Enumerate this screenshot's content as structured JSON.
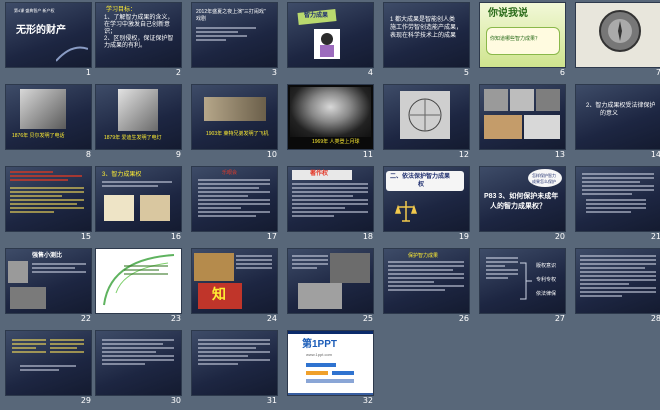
{
  "slides": [
    {
      "num": "1",
      "texts": [
        "无形的财产",
        "第4课  盛典智产 新产权"
      ]
    },
    {
      "num": "2",
      "texts": [
        "学习目标：",
        "1、了解智力成果的含义，",
        "在学习中激发自己创新意",
        "识；",
        "2、区别侵权，保证保护智",
        "力成果的有利。"
      ]
    },
    {
      "num": "3",
      "texts": [
        "2012年盛夏之夜上演\"三打闹戏\"",
        "戏剧"
      ]
    },
    {
      "num": "4",
      "texts": [
        "智力成果"
      ]
    },
    {
      "num": "5",
      "texts": [
        "1  都大成果是智能创人类",
        "施工作劳智创造能产成果，",
        "表现在科学技术上的成果"
      ]
    },
    {
      "num": "6",
      "texts": [
        "你说我说",
        "你知道哪些智力成果？"
      ]
    },
    {
      "num": "7",
      "texts": []
    },
    {
      "num": "8",
      "texts": [
        "1876年 贝尔发明了电话"
      ]
    },
    {
      "num": "9",
      "texts": [
        "1879年 爱迪生发明了电灯"
      ]
    },
    {
      "num": "10",
      "texts": [
        "1903年 莱特兄弟发明了飞机"
      ]
    },
    {
      "num": "11",
      "texts": [
        "1969年 人类登上月球"
      ]
    },
    {
      "num": "12",
      "texts": []
    },
    {
      "num": "13",
      "texts": []
    },
    {
      "num": "14",
      "texts": [
        "2、智力成果权受法律保护",
        "的意义"
      ]
    },
    {
      "num": "15",
      "texts": []
    },
    {
      "num": "16",
      "texts": [
        "3、智力成果权"
      ]
    },
    {
      "num": "17",
      "texts": [
        "乐眼会"
      ]
    },
    {
      "num": "18",
      "texts": [
        "著作权"
      ]
    },
    {
      "num": "19",
      "texts": [
        "二、依法保护智力成果",
        "权"
      ]
    },
    {
      "num": "20",
      "texts": [
        "怎样保护智力",
        "成果怎么保护",
        "P83 3、如何保护未成年",
        "人的智力成果权？"
      ]
    },
    {
      "num": "21",
      "texts": []
    },
    {
      "num": "22",
      "texts": [
        "强售小测比"
      ]
    },
    {
      "num": "23",
      "texts": []
    },
    {
      "num": "24",
      "texts": [
        "知"
      ]
    },
    {
      "num": "25",
      "texts": []
    },
    {
      "num": "26",
      "texts": [
        "保护智力成果"
      ]
    },
    {
      "num": "27",
      "texts": [
        "版权意识",
        "专利专权",
        "依法律保"
      ]
    },
    {
      "num": "28",
      "texts": []
    },
    {
      "num": "29",
      "texts": []
    },
    {
      "num": "30",
      "texts": []
    },
    {
      "num": "31",
      "texts": []
    },
    {
      "num": "32",
      "texts": [
        "第1PPT",
        "www.1ppt.com"
      ]
    }
  ]
}
